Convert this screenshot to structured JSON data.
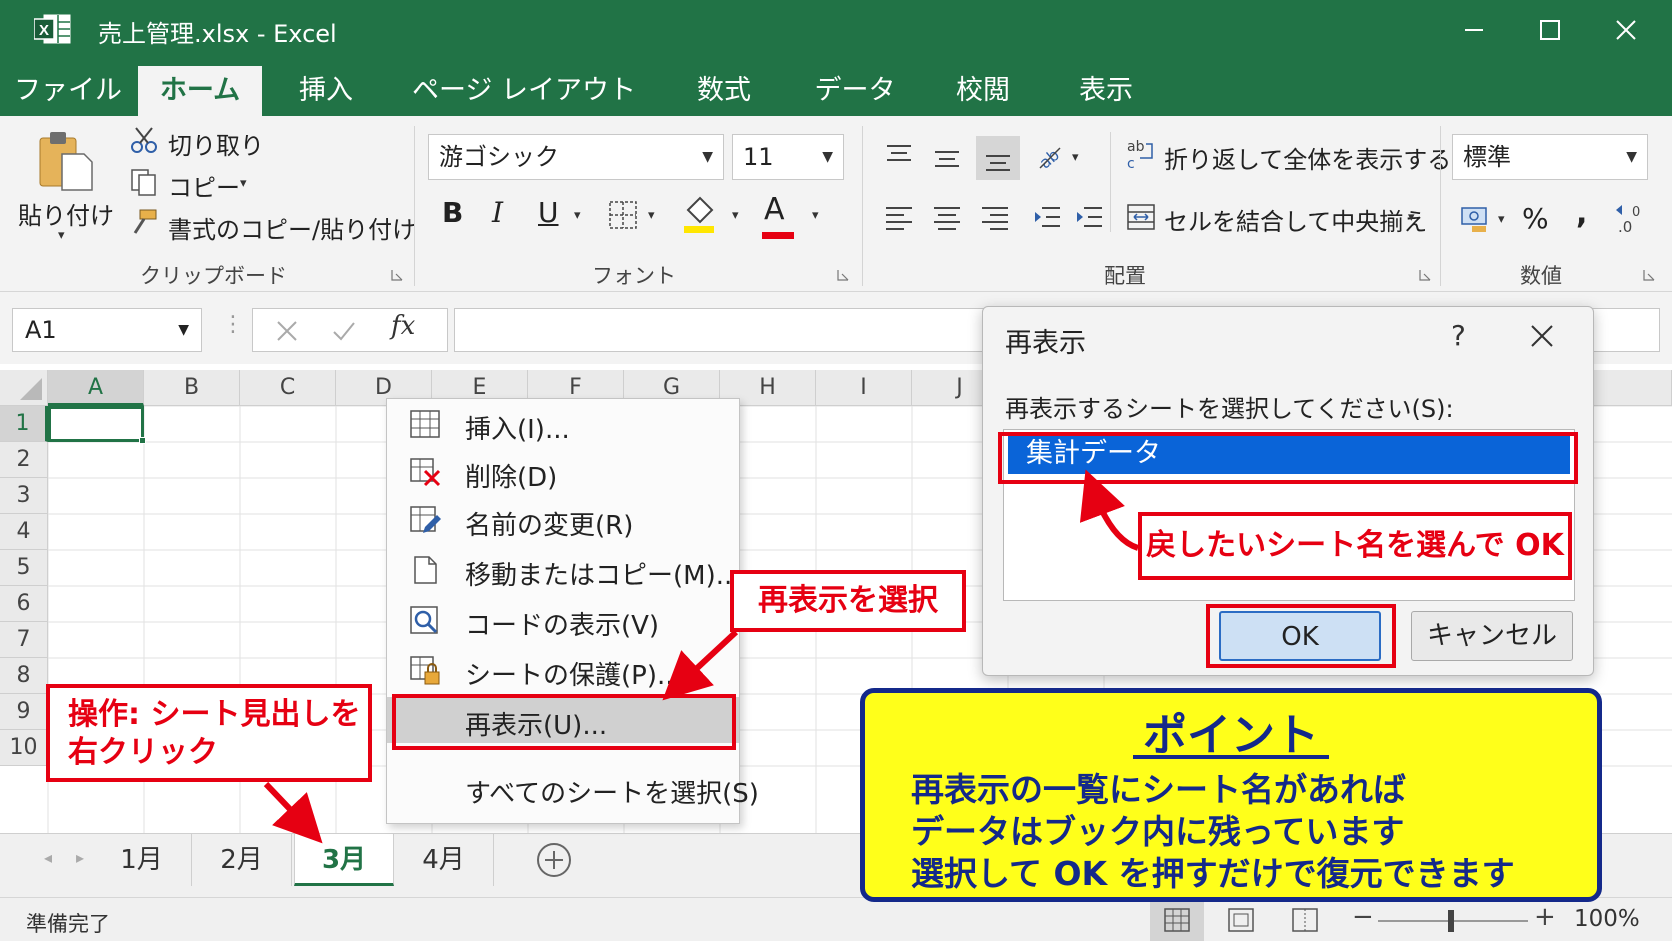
{
  "window": {
    "title": "売上管理.xlsx  -  Excel"
  },
  "ribbon_tabs": [
    "ファイル",
    "ホーム",
    "挿入",
    "ページ レイアウト",
    "数式",
    "データ",
    "校閲",
    "表示"
  ],
  "ribbon": {
    "clipboard": {
      "paste": "貼り付け",
      "cut": "切り取り",
      "copy": "コピー",
      "format_painter": "書式のコピー/貼り付け",
      "label": "クリップボード"
    },
    "font": {
      "name": "游ゴシック",
      "size": "11",
      "bold": "B",
      "italic": "I",
      "underline": "U",
      "font_color_glyph": "A",
      "label": "フォント"
    },
    "alignment": {
      "wrap": "折り返して全体を表示する",
      "merge": "セルを結合して中央揃え",
      "label": "配置"
    },
    "number": {
      "format": "標準",
      "percent": "%",
      "comma": ",",
      "label": "数値"
    }
  },
  "formula_bar": {
    "name_box": "A1",
    "fx": "fx"
  },
  "columns": [
    "A",
    "B",
    "C",
    "D",
    "E",
    "F",
    "G",
    "H",
    "I",
    "J"
  ],
  "rows": [
    "1",
    "2",
    "3",
    "4",
    "5",
    "6",
    "7",
    "8",
    "9",
    "10"
  ],
  "context_menu": {
    "items": [
      "挿入(I)...",
      "削除(D)",
      "名前の変更(R)",
      "移動またはコピー(M)...",
      "コードの表示(V)",
      "シートの保護(P)...",
      "再表示(U)...",
      "すべてのシートを選択(S)"
    ],
    "highlighted_index": 6
  },
  "sheet_tabs": [
    "1月",
    "2月",
    "3月",
    "4月"
  ],
  "active_sheet": "3月",
  "status": {
    "ready": "準備完了",
    "zoom": "100%"
  },
  "dialog": {
    "title": "再表示",
    "help": "?",
    "prompt": "再表示するシートを選択してください(S):",
    "list_items": [
      "集計データ"
    ],
    "ok": "OK",
    "cancel": "キャンセル"
  },
  "callouts": {
    "left_line1": "操作: シート見出しを",
    "left_line2": "右クリック",
    "mid": "再表示を選択",
    "dialog": "戻したいシート名を選んで OK"
  },
  "point_box": {
    "title": "ポイント",
    "lines": [
      "再表示の一覧にシート名があれば",
      "データはブック内に残っています",
      "選択して OK を押すだけで復元できます"
    ]
  },
  "colors": {
    "excel_green": "#217346",
    "callout_red": "#e60012",
    "point_yellow": "#ffff1a",
    "point_navy": "#14298a",
    "selection_blue": "#0a64d8"
  }
}
